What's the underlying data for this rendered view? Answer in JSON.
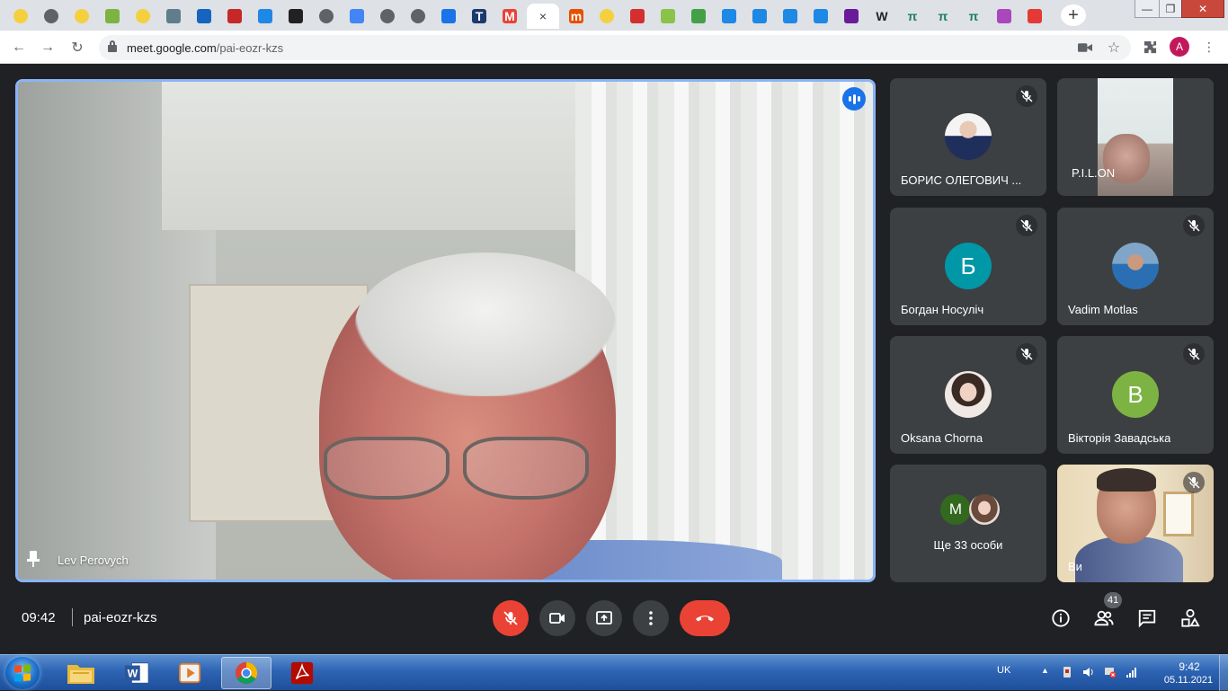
{
  "browser": {
    "tabs": [
      {
        "icon": "sun-favicon",
        "color": "#f4d03f"
      },
      {
        "icon": "globe-favicon",
        "color": "#5f6368"
      },
      {
        "icon": "sun-favicon",
        "color": "#f4d03f"
      },
      {
        "icon": "plant-favicon",
        "color": "#7cb342"
      },
      {
        "icon": "sun-favicon",
        "color": "#f4d03f"
      },
      {
        "icon": "building-favicon",
        "color": "#607d8b"
      },
      {
        "icon": "emblem-favicon",
        "color": "#1565c0"
      },
      {
        "icon": "crest-favicon",
        "color": "#c62828"
      },
      {
        "icon": "edge-favicon",
        "color": "#1e88e5"
      },
      {
        "icon": "shield-favicon",
        "color": "#212121"
      },
      {
        "icon": "globe-favicon",
        "color": "#5f6368"
      },
      {
        "icon": "translate-favicon",
        "color": "#4285f4"
      },
      {
        "icon": "globe-favicon",
        "color": "#5f6368"
      },
      {
        "icon": "globe-favicon",
        "color": "#5f6368"
      },
      {
        "icon": "download-favicon",
        "color": "#1a73e8"
      },
      {
        "icon": "t-favicon",
        "color": "#1a3b6e",
        "letter": "T"
      },
      {
        "icon": "gmail-favicon",
        "color": "#ea4335",
        "letter": "M"
      },
      {
        "icon": "meet-favicon",
        "color": "#00897b",
        "active": true
      },
      {
        "icon": "m-favicon",
        "color": "#e65100",
        "letter": "m"
      },
      {
        "icon": "sun-favicon",
        "color": "#f4d03f"
      },
      {
        "icon": "thermometer-favicon",
        "color": "#d32f2f"
      },
      {
        "icon": "gift-favicon",
        "color": "#8bc34a"
      },
      {
        "icon": "loop-favicon",
        "color": "#43a047"
      },
      {
        "icon": "classroom-favicon",
        "color": "#1e88e5"
      },
      {
        "icon": "classroom-favicon",
        "color": "#1e88e5"
      },
      {
        "icon": "classroom-favicon",
        "color": "#1e88e5"
      },
      {
        "icon": "classroom-favicon",
        "color": "#1e88e5"
      },
      {
        "icon": "square-favicon",
        "color": "#6a1b9a"
      },
      {
        "icon": "wikipedia-favicon",
        "color": "#ffffff",
        "letter": "W"
      },
      {
        "icon": "pi-favicon",
        "color": "#ffffff",
        "letter": "π"
      },
      {
        "icon": "pi-favicon",
        "color": "#ffffff",
        "letter": "π"
      },
      {
        "icon": "pi-favicon",
        "color": "#ffffff",
        "letter": "π"
      },
      {
        "icon": "smile-favicon",
        "color": "#ab47bc"
      },
      {
        "icon": "heart-favicon",
        "color": "#e53935"
      }
    ],
    "tab_close": "×",
    "new_tab": "+",
    "url_host": "meet.google.com",
    "url_path": "/pai-eozr-kzs",
    "profile_initial": "A"
  },
  "meet": {
    "main_speaker": "Lev Perovych",
    "participants": [
      {
        "name": "БОРИС ОЛЕГОВИЧ ...",
        "type": "photo",
        "muted": true
      },
      {
        "name": "P.I.L.ON",
        "type": "video",
        "muted": false
      },
      {
        "name": "Богдан Носуліч",
        "type": "letter",
        "initial": "Б",
        "color": "#0097a7",
        "muted": true
      },
      {
        "name": "Vadim Motlas",
        "type": "photo",
        "muted": true
      },
      {
        "name": "Oksana Chorna",
        "type": "photo",
        "muted": true
      },
      {
        "name": "Вікторія Завадська",
        "type": "letter",
        "initial": "В",
        "color": "#7cb342",
        "muted": true
      },
      {
        "name": "Ще 33 особи",
        "type": "more",
        "initial": "M",
        "color": "#33691e"
      },
      {
        "name": "Ви",
        "type": "video",
        "muted": true
      }
    ],
    "time": "09:42",
    "code": "pai-eozr-kzs",
    "participant_count": "41",
    "accent": "#8ab4f8",
    "hangup_color": "#ea4335"
  },
  "taskbar": {
    "language": "UK",
    "clock_time": "9:42",
    "clock_date": "05.11.2021"
  }
}
